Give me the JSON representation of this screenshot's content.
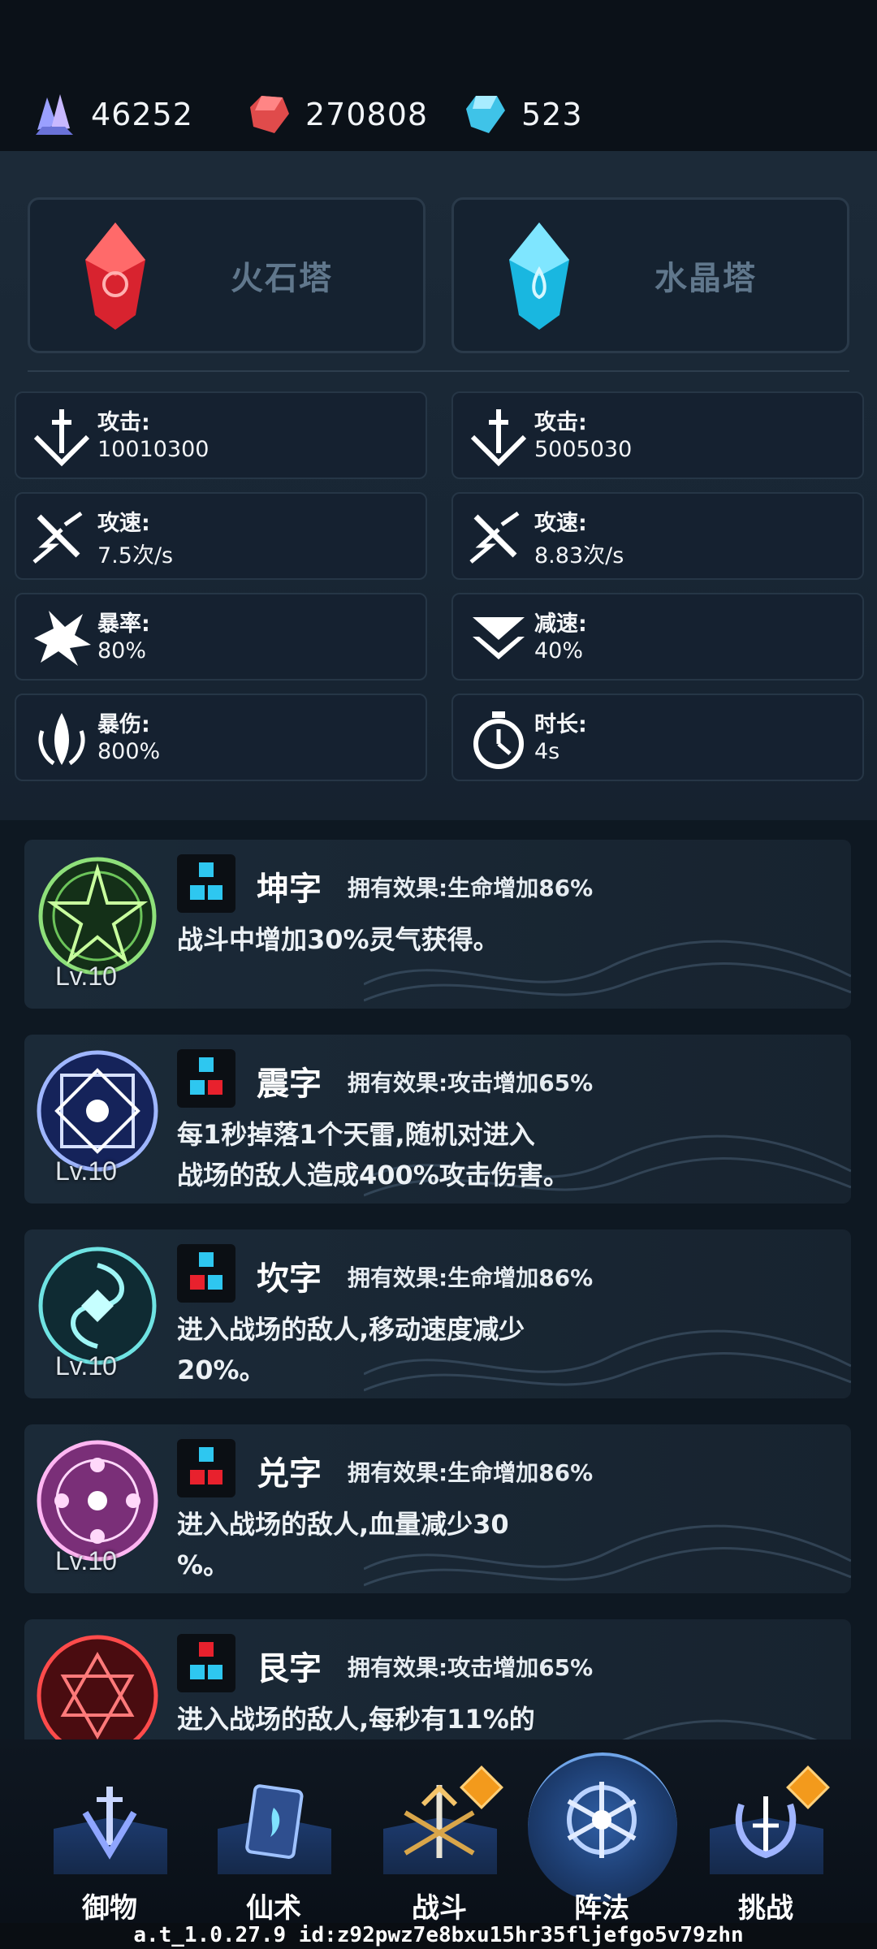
{
  "currencies": [
    {
      "icon": "purple-crystal-icon",
      "value": "46252"
    },
    {
      "icon": "red-gem-icon",
      "value": "270808"
    },
    {
      "icon": "blue-diamond-icon",
      "value": "523"
    }
  ],
  "towers": [
    {
      "icon": "fire-stone-crystal-icon",
      "name": "火石塔"
    },
    {
      "icon": "water-crystal-icon",
      "name": "水晶塔"
    }
  ],
  "stats_left": [
    {
      "icon": "sword-attack-icon",
      "label": "攻击:",
      "value": "10010300"
    },
    {
      "icon": "attack-speed-icon",
      "label": "攻速:",
      "value": "7.5次/s"
    },
    {
      "icon": "crit-rate-icon",
      "label": "暴率:",
      "value": "80%"
    },
    {
      "icon": "crit-damage-icon",
      "label": "暴伤:",
      "value": "800%"
    }
  ],
  "stats_right": [
    {
      "icon": "sword-attack-icon",
      "label": "攻击:",
      "value": "5005030"
    },
    {
      "icon": "attack-speed-icon",
      "label": "攻速:",
      "value": "8.83次/s"
    },
    {
      "icon": "slow-down-icon",
      "label": "减速:",
      "value": "40%"
    },
    {
      "icon": "stopwatch-icon",
      "label": "时长:",
      "value": "4s"
    }
  ],
  "formations": [
    {
      "emblem": "green-star-seal-icon",
      "level": "Lv.10",
      "title": "坤字",
      "effect": "拥有效果:生命增加86%",
      "desc": "战斗中增加30%灵气获得。"
    },
    {
      "emblem": "blue-rune-seal-icon",
      "level": "Lv.10",
      "title": "震字",
      "effect": "拥有效果:攻击增加65%",
      "desc": "每1秒掉落1个天雷,随机对进入\n战场的敌人造成400%攻击伤害。"
    },
    {
      "emblem": "teal-vortex-seal-icon",
      "level": "Lv.10",
      "title": "坎字",
      "effect": "拥有效果:生命增加86%",
      "desc": "进入战场的敌人,移动速度减少\n20%。"
    },
    {
      "emblem": "pink-circle-seal-icon",
      "level": "Lv.10",
      "title": "兑字",
      "effect": "拥有效果:生命增加86%",
      "desc": "进入战场的敌人,血量减少30\n%。"
    },
    {
      "emblem": "red-hexagram-seal-icon",
      "level": "",
      "title": "艮字",
      "effect": "拥有效果:攻击增加65%",
      "desc": "进入战场的敌人,每秒有11%的"
    }
  ],
  "nav": [
    {
      "icon": "sword-guard-icon",
      "label": "御物"
    },
    {
      "icon": "spell-card-icon",
      "label": "仙术"
    },
    {
      "icon": "battle-trident-icon",
      "label": "战斗"
    },
    {
      "icon": "formation-snowflake-icon",
      "label": "阵法"
    },
    {
      "icon": "challenge-emblem-icon",
      "label": "挑战"
    }
  ],
  "version": "a.t_1.0.27.9 id:z92pwz7e8bxu15hr35fljefgo5v79zhn"
}
